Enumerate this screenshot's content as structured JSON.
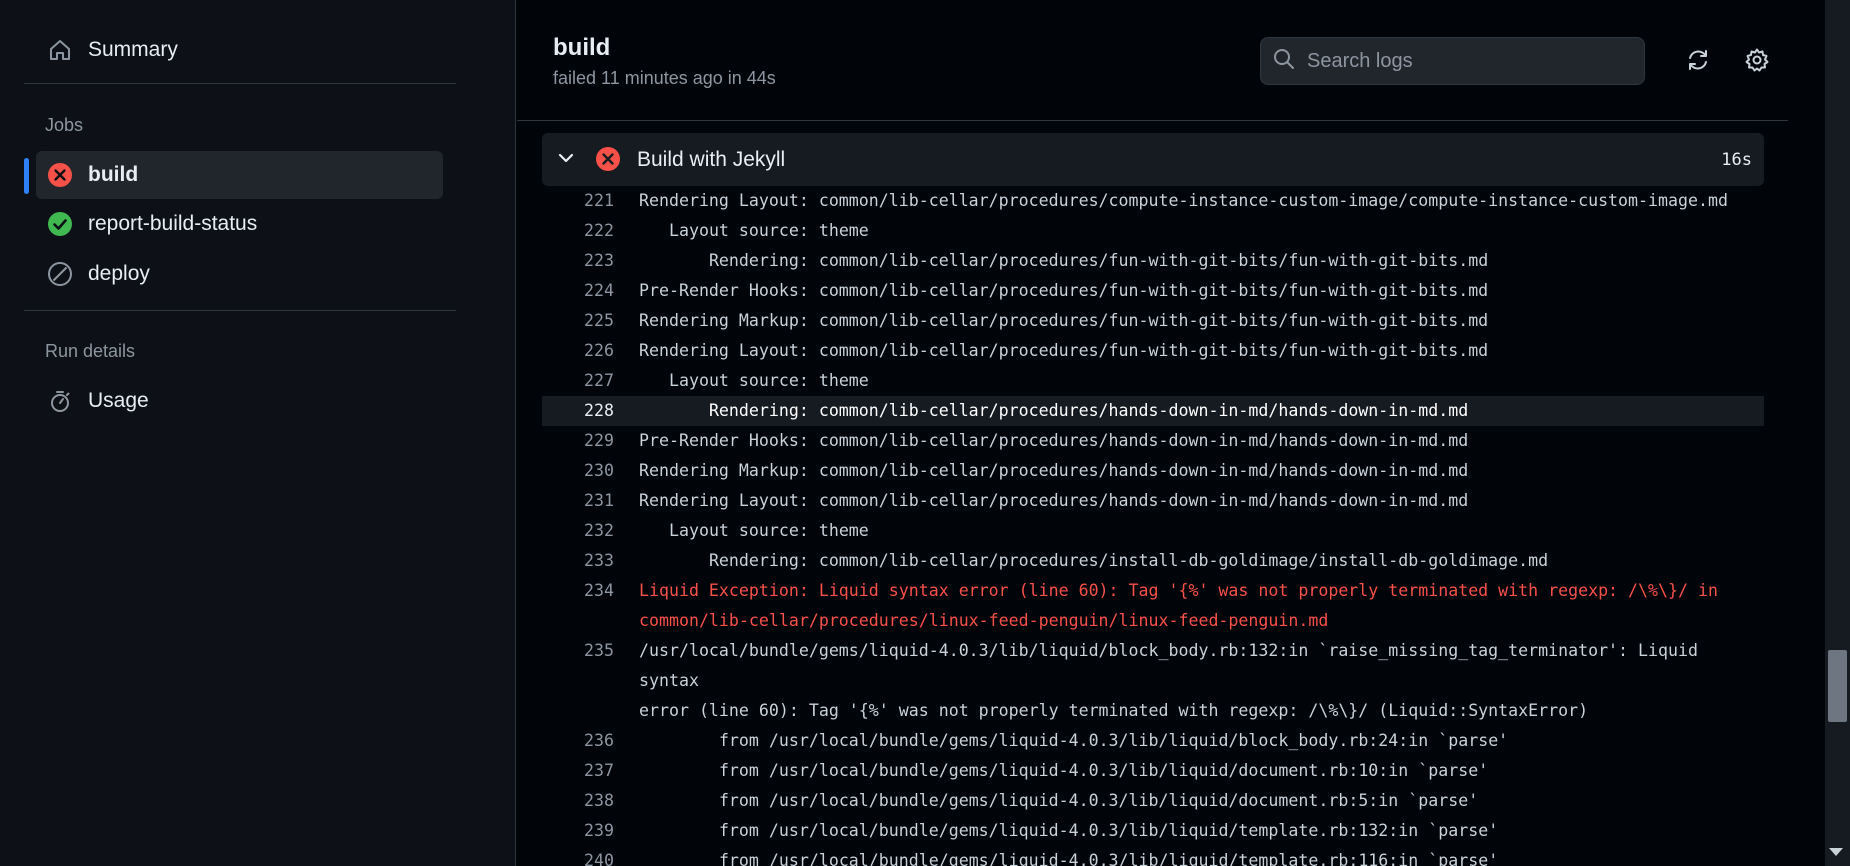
{
  "sidebar": {
    "summary_label": "Summary",
    "jobs_heading": "Jobs",
    "jobs": [
      {
        "label": "build",
        "status": "failed"
      },
      {
        "label": "report-build-status",
        "status": "success"
      },
      {
        "label": "deploy",
        "status": "skipped"
      }
    ],
    "run_details_heading": "Run details",
    "usage_label": "Usage"
  },
  "header": {
    "title": "build",
    "subtitle": "failed 11 minutes ago in 44s",
    "search_placeholder": "Search logs"
  },
  "step": {
    "name": "Build with Jekyll",
    "duration": "16s",
    "status": "failed"
  },
  "log_lines": [
    {
      "n": "221",
      "text": "Rendering Layout: common/lib-cellar/procedures/compute-instance-custom-image/compute-instance-custom-image.md",
      "type": "normal"
    },
    {
      "n": "222",
      "text": "   Layout source: theme",
      "type": "normal"
    },
    {
      "n": "223",
      "text": "       Rendering: common/lib-cellar/procedures/fun-with-git-bits/fun-with-git-bits.md",
      "type": "normal"
    },
    {
      "n": "224",
      "text": "Pre-Render Hooks: common/lib-cellar/procedures/fun-with-git-bits/fun-with-git-bits.md",
      "type": "normal"
    },
    {
      "n": "225",
      "text": "Rendering Markup: common/lib-cellar/procedures/fun-with-git-bits/fun-with-git-bits.md",
      "type": "normal"
    },
    {
      "n": "226",
      "text": "Rendering Layout: common/lib-cellar/procedures/fun-with-git-bits/fun-with-git-bits.md",
      "type": "normal"
    },
    {
      "n": "227",
      "text": "   Layout source: theme",
      "type": "normal"
    },
    {
      "n": "228",
      "text": "       Rendering: common/lib-cellar/procedures/hands-down-in-md/hands-down-in-md.md",
      "type": "highlight"
    },
    {
      "n": "229",
      "text": "Pre-Render Hooks: common/lib-cellar/procedures/hands-down-in-md/hands-down-in-md.md",
      "type": "normal"
    },
    {
      "n": "230",
      "text": "Rendering Markup: common/lib-cellar/procedures/hands-down-in-md/hands-down-in-md.md",
      "type": "normal"
    },
    {
      "n": "231",
      "text": "Rendering Layout: common/lib-cellar/procedures/hands-down-in-md/hands-down-in-md.md",
      "type": "normal"
    },
    {
      "n": "232",
      "text": "   Layout source: theme",
      "type": "normal"
    },
    {
      "n": "233",
      "text": "       Rendering: common/lib-cellar/procedures/install-db-goldimage/install-db-goldimage.md",
      "type": "normal"
    },
    {
      "n": "234",
      "text": "Liquid Exception: Liquid syntax error (line 60): Tag '{%' was not properly terminated with regexp: /\\%\\}/ in\ncommon/lib-cellar/procedures/linux-feed-penguin/linux-feed-penguin.md",
      "type": "error"
    },
    {
      "n": "235",
      "text": "/usr/local/bundle/gems/liquid-4.0.3/lib/liquid/block_body.rb:132:in `raise_missing_tag_terminator': Liquid syntax\nerror (line 60): Tag '{%' was not properly terminated with regexp: /\\%\\}/ (Liquid::SyntaxError)",
      "type": "normal"
    },
    {
      "n": "236",
      "text": "        from /usr/local/bundle/gems/liquid-4.0.3/lib/liquid/block_body.rb:24:in `parse'",
      "type": "normal"
    },
    {
      "n": "237",
      "text": "        from /usr/local/bundle/gems/liquid-4.0.3/lib/liquid/document.rb:10:in `parse'",
      "type": "normal"
    },
    {
      "n": "238",
      "text": "        from /usr/local/bundle/gems/liquid-4.0.3/lib/liquid/document.rb:5:in `parse'",
      "type": "normal"
    },
    {
      "n": "239",
      "text": "        from /usr/local/bundle/gems/liquid-4.0.3/lib/liquid/template.rb:132:in `parse'",
      "type": "normal"
    },
    {
      "n": "240",
      "text": "        from /usr/local/bundle/gems/liquid-4.0.3/lib/liquid/template.rb:116:in `parse'",
      "type": "normal"
    }
  ],
  "colors": {
    "failed": "#f85149",
    "success": "#3fb950",
    "accent": "#2f81f7"
  }
}
